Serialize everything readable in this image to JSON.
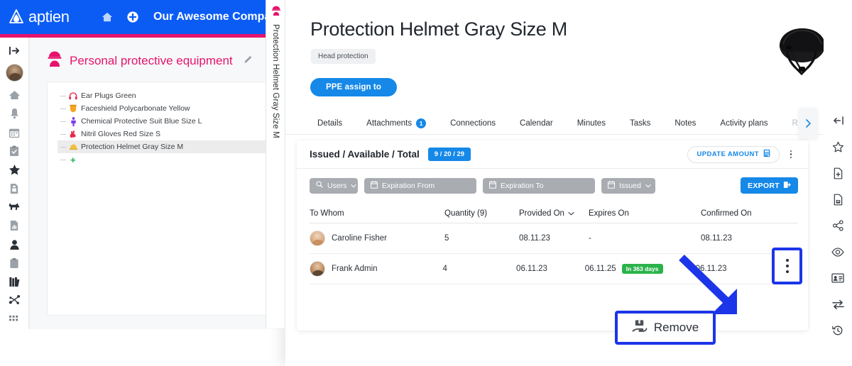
{
  "topbar": {
    "brand": "aptien",
    "home_icon": "home-icon",
    "add_icon": "plus-circle-icon",
    "company": "Our Awesome Company"
  },
  "left_rail": {
    "items": [
      {
        "name": "expand-panel-icon",
        "label": "Expand"
      },
      {
        "name": "user-avatar",
        "label": "User"
      },
      {
        "name": "home-icon",
        "label": "Home"
      },
      {
        "name": "bell-icon",
        "label": "Notifications"
      },
      {
        "name": "calendar-icon",
        "label": "Calendar"
      },
      {
        "name": "clipboard-check-icon",
        "label": "Tasks"
      },
      {
        "name": "star-icon",
        "label": "Favorites"
      },
      {
        "name": "document-icon",
        "label": "Documents"
      },
      {
        "name": "dog-icon",
        "label": "Animals"
      },
      {
        "name": "report-icon",
        "label": "Reports"
      },
      {
        "name": "person-icon",
        "label": "People"
      },
      {
        "name": "clipboard-icon",
        "label": "Clipboard"
      },
      {
        "name": "books-icon",
        "label": "Library"
      },
      {
        "name": "molecule-icon",
        "label": "Assets"
      },
      {
        "name": "grid-icon",
        "label": "Apps"
      }
    ]
  },
  "left_panel": {
    "title": "Personal protective equipment",
    "edit_icon": "pencil-icon",
    "header_icon": "helmet-person-icon",
    "tree": [
      {
        "label": "Ear Plugs Green",
        "icon": "earmuffs-icon",
        "color": "#e8294a",
        "selected": false
      },
      {
        "label": "Faceshield Polycarbonate Yellow",
        "icon": "faceshield-icon",
        "color": "#f5a623",
        "selected": false
      },
      {
        "label": "Chemical Protective Suit Blue Size L",
        "icon": "suit-icon",
        "color": "#7a3df0",
        "selected": false
      },
      {
        "label": "Nitril Gloves Red Size S",
        "icon": "glove-icon",
        "color": "#e8294a",
        "selected": false
      },
      {
        "label": "Protection Helmet Gray Size M",
        "icon": "helmet-icon",
        "color": "#f0c040",
        "selected": true
      }
    ],
    "add_label": "+"
  },
  "vertical_tab": {
    "label": "Protection Helmet Gray Size M",
    "icon": "helmet-person-icon"
  },
  "panel": {
    "close_icon": "close-icon",
    "product_image": "safety-helmet-photo",
    "title": "Protection Helmet Gray Size M",
    "tag": "Head protection",
    "assign_button": "PPE assign to",
    "tabs": [
      {
        "label": "Details",
        "badge": "",
        "dim": false
      },
      {
        "label": "Attachments",
        "badge": "1",
        "dim": false
      },
      {
        "label": "Connections",
        "badge": "",
        "dim": false
      },
      {
        "label": "Calendar",
        "badge": "",
        "dim": false
      },
      {
        "label": "Minutes",
        "badge": "",
        "dim": false
      },
      {
        "label": "Tasks",
        "badge": "",
        "dim": false
      },
      {
        "label": "Notes",
        "badge": "",
        "dim": false
      },
      {
        "label": "Activity plans",
        "badge": "",
        "dim": false
      },
      {
        "label": "Reque",
        "badge": "",
        "dim": true
      }
    ],
    "tabs_next_icon": "chevron-right-icon"
  },
  "card": {
    "title": "Issued / Available / Total",
    "badge": "9 / 20 / 29",
    "update_button": "UPDATE AMOUNT",
    "update_icon": "calculator-icon",
    "kebab_icon": "kebab-menu-icon",
    "filters": [
      {
        "label": "Users",
        "icon": "search-icon",
        "chevron": true,
        "width": "w-users"
      },
      {
        "label": "Expiration From",
        "icon": "calendar-icon",
        "chevron": false,
        "width": "w-from"
      },
      {
        "label": "Expiration To",
        "icon": "calendar-icon",
        "chevron": false,
        "width": "w-to"
      },
      {
        "label": "Issued",
        "icon": "calendar-icon",
        "chevron": true,
        "width": "w-issued"
      }
    ],
    "export_button": "EXPORT",
    "export_icon": "export-icon",
    "columns": [
      "To Whom",
      "Quantity (9)",
      "Provided On",
      "Expires On",
      "Confirmed On"
    ],
    "sort_column": "Provided On",
    "rows": [
      {
        "who": "Caroline Fisher",
        "avatar": "a1",
        "quantity": "5",
        "provided_on": "08.11.23",
        "expires_on": "-",
        "expires_badge": "",
        "confirmed_on": "08.11.23"
      },
      {
        "who": "Frank Admin",
        "avatar": "a2",
        "quantity": "4",
        "provided_on": "06.11.23",
        "expires_on": "06.11.25",
        "expires_badge": "In 363 days",
        "confirmed_on": "06.11.23"
      }
    ]
  },
  "callout": {
    "label": "Remove",
    "icon": "remove-hand-box-icon",
    "highlight_color": "#1c35e8"
  },
  "right_rail": {
    "items": [
      {
        "name": "collapse-left-icon",
        "label": "Collapse"
      },
      {
        "name": "star-icon",
        "label": "Favorite"
      },
      {
        "name": "document-add-icon",
        "label": "New document"
      },
      {
        "name": "document-save-icon",
        "label": "Save document"
      },
      {
        "name": "share-icon",
        "label": "Share"
      },
      {
        "name": "eye-icon",
        "label": "Watch"
      },
      {
        "name": "id-card-icon",
        "label": "Card"
      },
      {
        "name": "transfer-icon",
        "label": "Transfer"
      },
      {
        "name": "history-icon",
        "label": "History"
      }
    ]
  },
  "colors": {
    "brand_blue": "#0b5cf5",
    "accent_pink": "#e6136c",
    "action_blue": "#1588e8",
    "green_badge": "#2bb34b",
    "highlight": "#1c35e8"
  }
}
